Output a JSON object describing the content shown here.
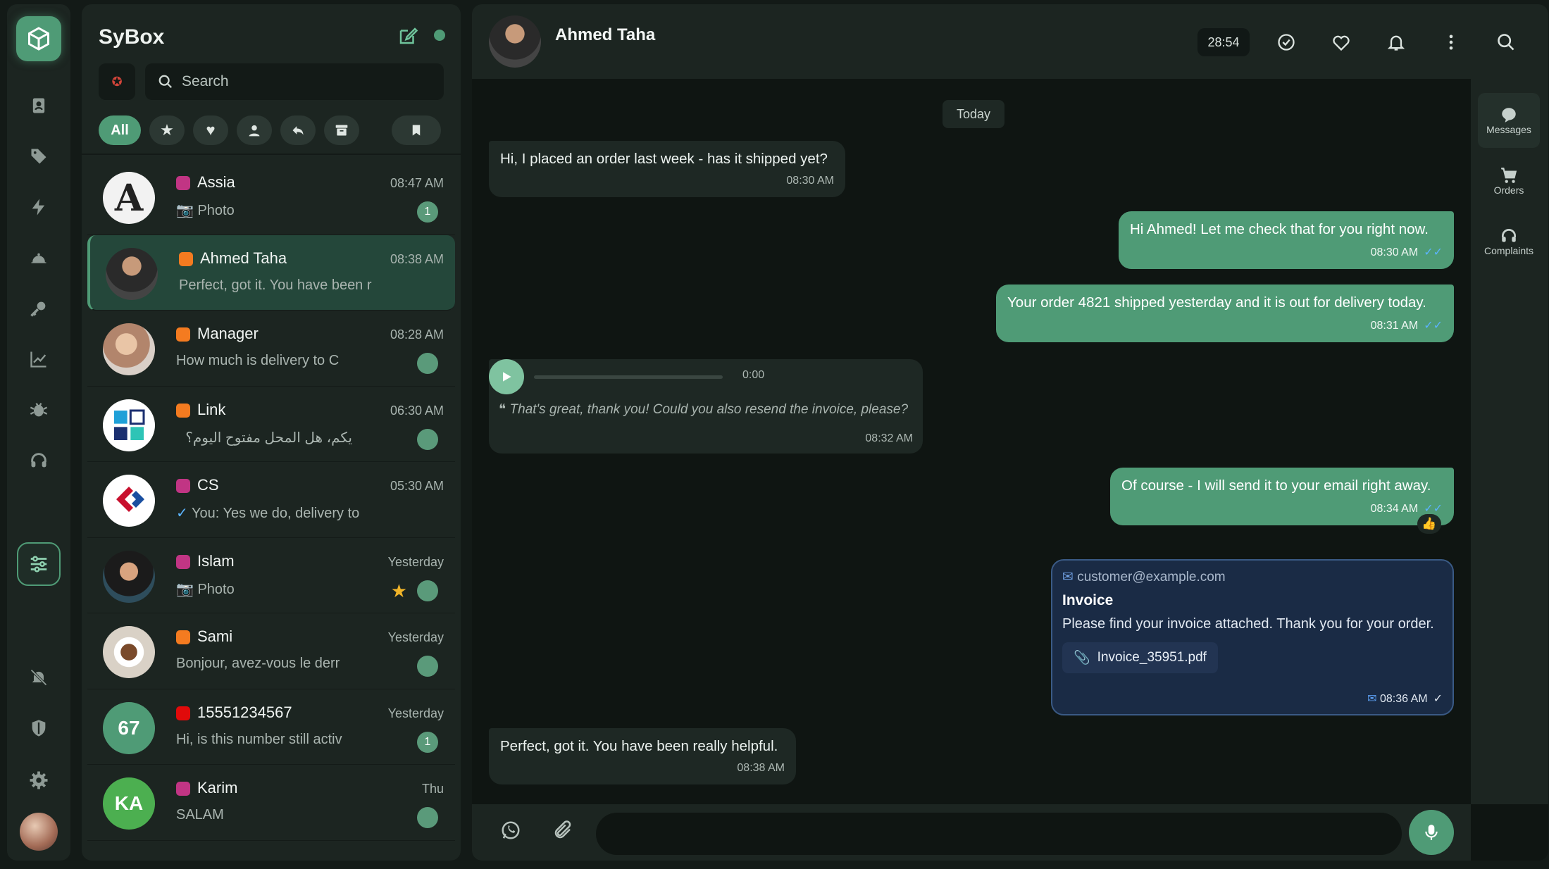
{
  "app": {
    "title": "SyBox"
  },
  "search": {
    "placeholder": "Search"
  },
  "filters": {
    "all_label": "All"
  },
  "chats": [
    {
      "name": "Assia",
      "time": "08:47 AM",
      "preview": "📷 Photo",
      "badge": "1",
      "source": "instagram",
      "avatar_text": "A"
    },
    {
      "name": "Ahmed Taha",
      "time": "08:38 AM",
      "preview": "Perfect, got it. You have been r",
      "badge": "",
      "source": "orange"
    },
    {
      "name": "Manager",
      "time": "08:28 AM",
      "preview": "How much is delivery to C",
      "badge": "",
      "source": "orange"
    },
    {
      "name": "Link",
      "time": "06:30 AM",
      "preview": "يكم، هل المحل مفتوح اليوم؟",
      "badge": "",
      "source": "orange"
    },
    {
      "name": "CS",
      "time": "05:30 AM",
      "preview": "You: Yes we do, delivery to",
      "badge": "",
      "source": "instagram"
    },
    {
      "name": "Islam",
      "time": "Yesterday",
      "preview": "📷 Photo",
      "badge": "",
      "source": "instagram",
      "starred": true
    },
    {
      "name": "Sami",
      "time": "Yesterday",
      "preview": "Bonjour, avez-vous le derr",
      "badge": "",
      "source": "orange"
    },
    {
      "name": "15551234567",
      "time": "Yesterday",
      "preview": "Hi, is this number still activ",
      "badge": "1",
      "source": "virgin",
      "avatar_text": "67"
    },
    {
      "name": "Karim",
      "time": "Thu",
      "preview": "SALAM",
      "badge": "",
      "source": "instagram",
      "avatar_text": "KA"
    }
  ],
  "conversation": {
    "contact_name": "Ahmed Taha",
    "timer": "28:54",
    "day_label": "Today",
    "messages": [
      {
        "dir": "in",
        "text": "Hi, I placed an order last week - has it shipped yet?",
        "time": "08:30 AM"
      },
      {
        "dir": "out",
        "text": "Hi Ahmed! Let me check that for you right now.",
        "time": "08:30 AM"
      },
      {
        "dir": "out",
        "text": "Your order 4821 shipped yesterday and it is out for delivery today.",
        "time": "08:31 AM"
      },
      {
        "dir": "in",
        "type": "audio",
        "duration": "0:00",
        "transcript": "That's great, thank you! Could you also resend the invoice, please?",
        "time": "08:32 AM"
      },
      {
        "dir": "out",
        "text": "Of course - I will send it to your email right away.",
        "time": "08:34 AM",
        "reaction": "👍"
      },
      {
        "dir": "out",
        "type": "email",
        "to": "customer@example.com",
        "subject": "Invoice",
        "body": "Please find your invoice attached. Thank you for your order.",
        "attachment": "Invoice_35951.pdf",
        "time": "08:36 AM"
      },
      {
        "dir": "in",
        "text": "Perfect, got it. You have been really helpful.",
        "time": "08:38 AM"
      }
    ]
  },
  "side_tabs": [
    {
      "label": "Messages"
    },
    {
      "label": "Orders"
    },
    {
      "label": "Complaints"
    }
  ],
  "colors": {
    "accent": "#4f9b76",
    "bg": "#131a17",
    "panel": "#1c2521",
    "email": "#1a2b45"
  }
}
